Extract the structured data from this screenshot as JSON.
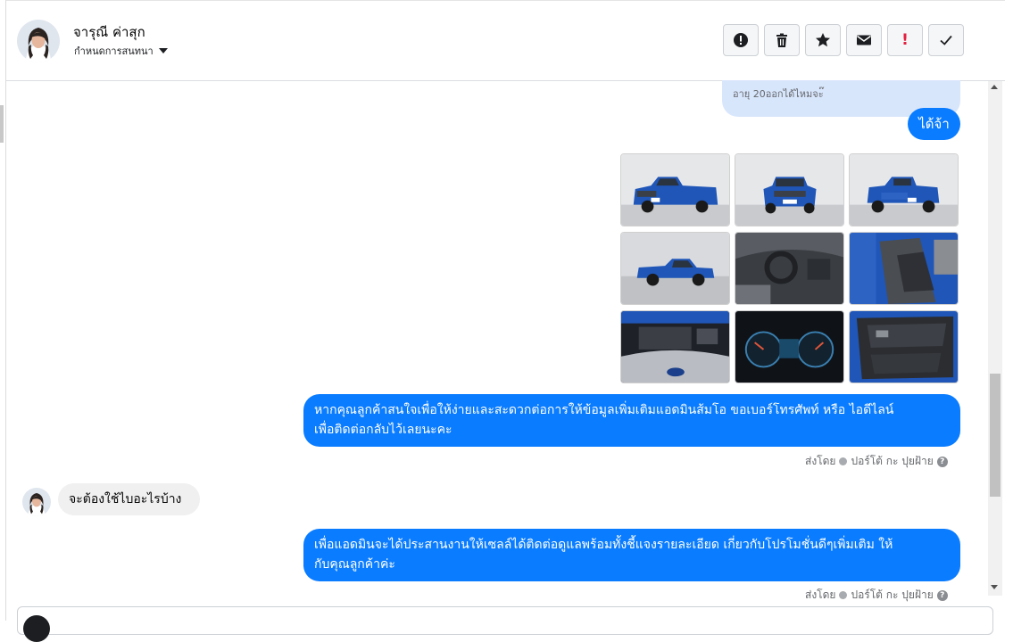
{
  "header": {
    "contact_name": "จารุณี ค่าสุก",
    "subtitle": "กำหนดการสนทนา",
    "actions": [
      {
        "icon": "alert-circle-icon",
        "kind": "svg"
      },
      {
        "icon": "trash-icon",
        "kind": "svg"
      },
      {
        "icon": "star-icon",
        "kind": "svg"
      },
      {
        "icon": "envelope-icon",
        "kind": "svg"
      },
      {
        "icon": "exclamation-icon",
        "kind": "text",
        "glyph": "!",
        "color": "#e41e3f"
      },
      {
        "icon": "checkmark-icon",
        "kind": "svg"
      }
    ]
  },
  "messages": {
    "quoted_reply": "อายุ 20ออกได้ไหมจะ๊",
    "reply_short": "ได้จ้า",
    "photos": [
      {
        "subject": "pickup-front-left"
      },
      {
        "subject": "pickup-front"
      },
      {
        "subject": "pickup-rear"
      },
      {
        "subject": "pickup-side"
      },
      {
        "subject": "interior-dashboard"
      },
      {
        "subject": "interior-seats"
      },
      {
        "subject": "engine-bay"
      },
      {
        "subject": "instrument-cluster"
      },
      {
        "subject": "door-panel"
      }
    ],
    "offer_line1": "หากคุณลูกค้าสนใจเพื่อให้ง่ายและสะดวกต่อการให้ข้อมูลเพิ่มเติมแอดมินส้มโอ ขอเบอร์โทรศัพท์ หรือ ไอดีไลน์",
    "offer_line2": "เพื่อติดต่อกลับไว้เลยนะคะ",
    "sent_by_1": "ส่งโดย",
    "sender_name_1": "ปอร์โต้ กะ ปุยฝ้าย",
    "incoming": "จะต้องใช้ไบอะไรบ้าง",
    "admin_line1": "เพื่อแอดมินจะได้ประสานงานให้เซลล์ได้ติดต่อดูแลพร้อมทั้งชี้แจงรายละเอียด เกี่ยวกับโปรโมชั่นดีๆเพิ่มเติม ให้",
    "admin_line2": "กับคุณลูกค้าค่ะ",
    "sent_by_2": "ส่งโดย",
    "sender_name_2": "ปอร์โต้ กะ ปุยฝ้าย"
  },
  "colors": {
    "outgoing_bubble": "#0a7cff",
    "quoted_bubble": "#d8e6fc",
    "incoming_bubble": "#f0f0f0",
    "truck_blue": "#1f56b8"
  }
}
